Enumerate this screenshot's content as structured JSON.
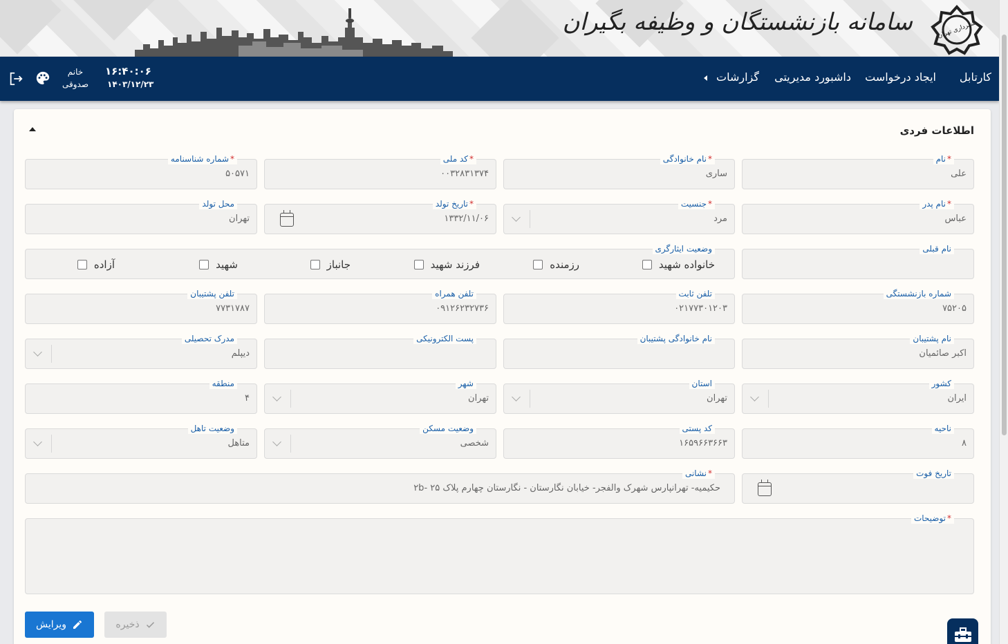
{
  "banner": {
    "title": "سامانه بازنشستگان و وظیفه بگیران",
    "logo_text": "شهرداری تهران"
  },
  "nav": {
    "items": [
      "کارتابل",
      "ایجاد درخواست",
      "داشبورد مدیریتی",
      "گزارشات"
    ],
    "user_line1": "خانم",
    "user_line2": "صدوقی",
    "clock": "۱۶:۴۰:۰۶",
    "date": "۱۴۰۳/۱۲/۲۳"
  },
  "section": {
    "title": "اطلاعات فردی"
  },
  "fields": {
    "first_name": {
      "label": "نام",
      "value": "علی"
    },
    "last_name": {
      "label": "نام خانوادگی",
      "value": "ساری"
    },
    "national_code": {
      "label": "کد ملی",
      "value": "۰۰۳۲۸۳۱۳۷۴"
    },
    "id_number": {
      "label": "شماره شناسنامه",
      "value": "۵۰۵۷۱"
    },
    "father_name": {
      "label": "نام پدر",
      "value": "عباس"
    },
    "gender": {
      "label": "جنسیت",
      "value": "مرد"
    },
    "birth_date": {
      "label": "تاریخ تولد",
      "value": "۱۳۳۲/۱۱/۰۶"
    },
    "birth_place": {
      "label": "محل تولد",
      "value": "تهران"
    },
    "prev_name": {
      "label": "نام قبلی",
      "value": ""
    },
    "sacrifice_status": {
      "label": "وضعیت ایثارگری"
    },
    "retirement_no": {
      "label": "شماره بازنشستگی",
      "value": "۷۵۲۰۵"
    },
    "landline": {
      "label": "تلفن ثابت",
      "value": "۰۲۱۷۷۳۰۱۲۰۳"
    },
    "mobile": {
      "label": "تلفن همراه",
      "value": "۰۹۱۲۶۲۳۲۷۳۶"
    },
    "support_phone": {
      "label": "تلفن پشتیبان",
      "value": "۷۷۳۱۷۸۷"
    },
    "support_name": {
      "label": "نام پشتیبان",
      "value": "اکبر صائمیان"
    },
    "support_last_name": {
      "label": "نام خانوادگی پشتیبان",
      "value": ""
    },
    "email": {
      "label": "پست الکترونیکی",
      "value": ""
    },
    "education": {
      "label": "مدرک تحصیلی",
      "value": "دیپلم"
    },
    "country": {
      "label": "کشور",
      "value": "ایران"
    },
    "province": {
      "label": "استان",
      "value": "تهران"
    },
    "city": {
      "label": "شهر",
      "value": "تهران"
    },
    "district": {
      "label": "منطقه",
      "value": "۴"
    },
    "area": {
      "label": "ناحیه",
      "value": "۸"
    },
    "postal_code": {
      "label": "کد پستی",
      "value": "۱۶۵۹۶۶۳۶۶۳"
    },
    "housing": {
      "label": "وضعیت مسکن",
      "value": "شخصی"
    },
    "marital": {
      "label": "وضعیت تاهل",
      "value": "متاهل"
    },
    "death_date": {
      "label": "تاریخ فوت",
      "value": ""
    },
    "address": {
      "label": "نشانی",
      "value": "حکیمیه- تهرانپارس شهرک والفجر- خیابان نگارستان - نگارستان چهارم پلاک ۲۵ -۲b"
    },
    "notes": {
      "label": "توضیحات",
      "value": ""
    }
  },
  "required_mark": "*",
  "checkboxes": [
    "خانواده شهید",
    "رزمنده",
    "فرزند شهید",
    "جانباز",
    "شهید",
    "آزاده"
  ],
  "buttons": {
    "edit": "ویرایش",
    "save": "ذخیره"
  },
  "colors": {
    "navbar": "#062f5e",
    "label": "#1a5fa8",
    "required": "#d32f2f",
    "edit_button": "#1976d2"
  }
}
